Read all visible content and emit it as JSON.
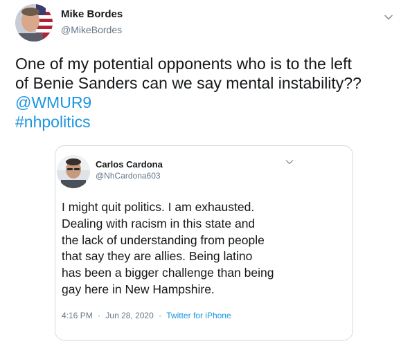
{
  "tweet": {
    "author_name": "Mike Bordes",
    "author_handle": "@MikeBordes",
    "text_lines": [
      "One of my potential opponents who is to the left",
      "of Benie Sanders can we say mental instability??"
    ],
    "mention": "@WMUR9",
    "hashtag": "#nhpolitics"
  },
  "quoted": {
    "author_name": "Carlos Cardona",
    "author_handle": "@NhCardona603",
    "text_lines": [
      "I might quit politics. I am exhausted.",
      "Dealing with racism in this state and",
      "the lack of understanding from people",
      "that say they are allies. Being latino",
      "has been a bigger challenge than being",
      "gay here in New Hampshire."
    ],
    "time": "4:16 PM",
    "date": "Jun 28, 2020",
    "separator": "·",
    "source": "Twitter for iPhone"
  },
  "icons": {
    "main_menu": "chevron-down-icon",
    "quoted_menu": "chevron-down-icon"
  },
  "colors": {
    "link": "#1b95e0",
    "text": "#14171a",
    "muted": "#657786",
    "card_border": "#d3dbe1"
  }
}
